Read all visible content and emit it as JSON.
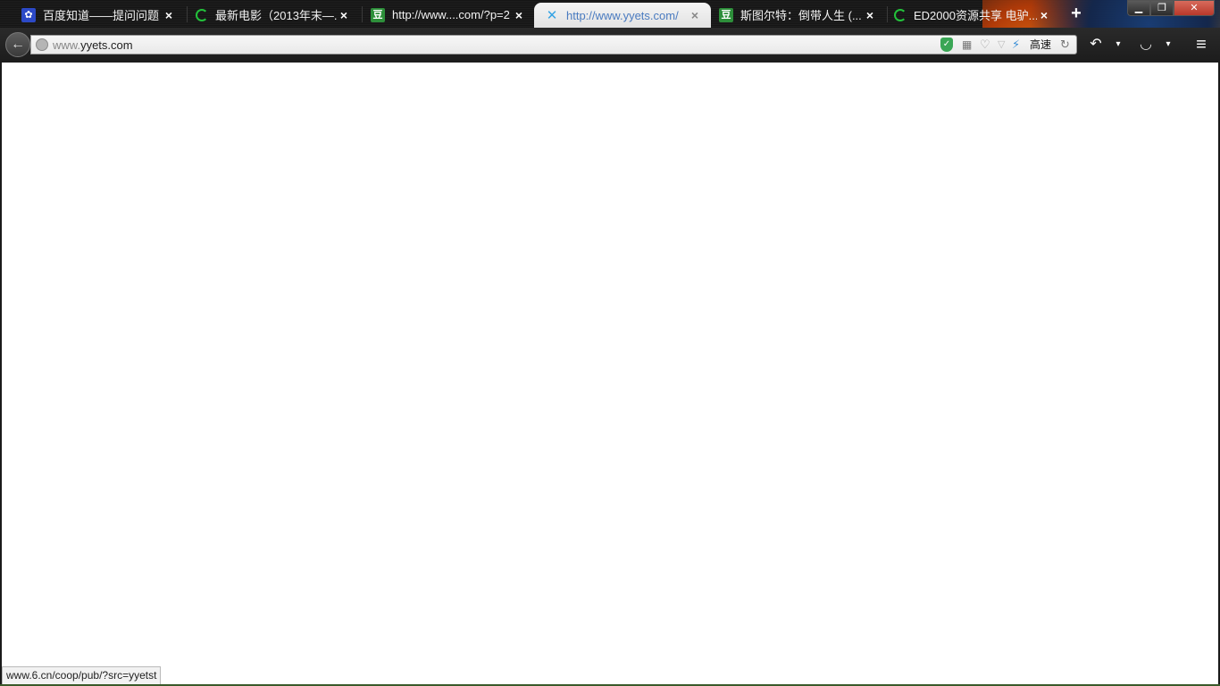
{
  "tabs": [
    {
      "title": "百度知道——提问问题",
      "favicon": "paw-icon",
      "close": "×"
    },
    {
      "title": "最新电影（2013年末—...",
      "favicon": "loading-icon",
      "close": "×"
    },
    {
      "title": "http://www....com/?p=2",
      "favicon": "douban-icon",
      "close": "×"
    },
    {
      "title": "http://www.yyets.com/",
      "favicon": "yyets-icon",
      "close": "×",
      "active": true
    },
    {
      "title": "斯图尔特：倒带人生 (...",
      "favicon": "douban-icon",
      "close": "×"
    },
    {
      "title": "ED2000资源共享 电驴...",
      "favicon": "loading-icon",
      "close": "×"
    }
  ],
  "new_tab": "+",
  "window_controls": {
    "minimize": "▁",
    "maximize": "❐",
    "close": "✕"
  },
  "navbar": {
    "back": "←",
    "url_prefix": "www.",
    "url_domain": "yyets.com",
    "speed_label": "高速",
    "reload": "↻",
    "undo": "↶",
    "dropdown": "▾",
    "menu": "≡"
  },
  "status_text": "www.6.cn/coop/pub/?src=yyetst",
  "colors": {
    "active_tab_text": "#4a7bc0",
    "titlebar": "#1a1a1a",
    "content": "#ffffff"
  }
}
